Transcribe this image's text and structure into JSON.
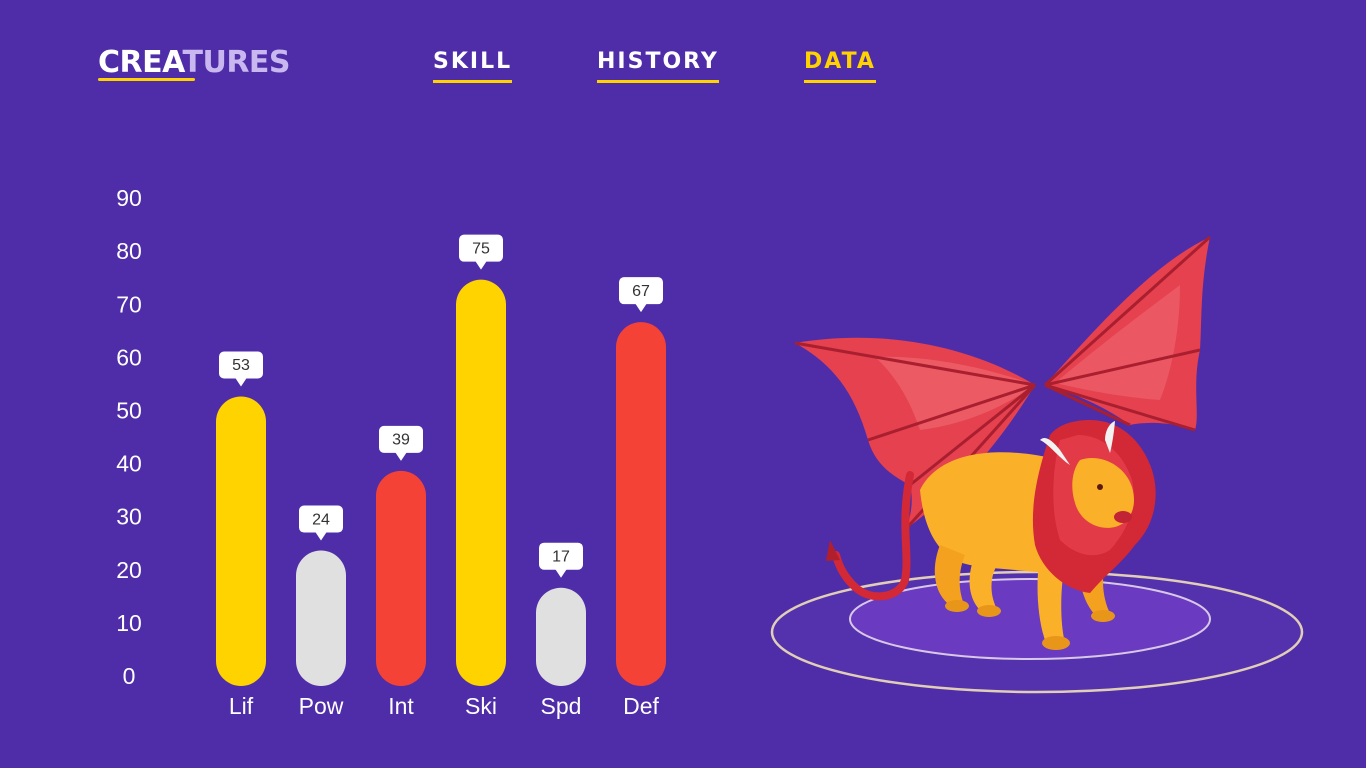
{
  "header": {
    "logo_part1": "CREA",
    "logo_part2": "TURES",
    "nav": [
      {
        "label": "SKILL",
        "active": false
      },
      {
        "label": "HISTORY",
        "active": false
      },
      {
        "label": "DATA",
        "active": true
      }
    ]
  },
  "colors": {
    "background": "#4F2DA8",
    "accent_yellow": "#FFD300",
    "accent_red": "#F44336",
    "neutral_gray": "#E0E0E0"
  },
  "chart_data": {
    "type": "bar",
    "title": "",
    "xlabel": "",
    "ylabel": "",
    "ylim": [
      0,
      90
    ],
    "yticks": [
      0,
      10,
      20,
      30,
      40,
      50,
      60,
      70,
      80,
      90
    ],
    "grid": false,
    "legend": "none",
    "categories": [
      "Lif",
      "Pow",
      "Int",
      "Ski",
      "Spd",
      "Def"
    ],
    "values": [
      53,
      24,
      39,
      75,
      17,
      67
    ],
    "bar_colors": [
      "#FFD300",
      "#E0E0E0",
      "#F44336",
      "#FFD300",
      "#E0E0E0",
      "#F44336"
    ],
    "data_labels": [
      "53",
      "24",
      "39",
      "75",
      "17",
      "67"
    ]
  },
  "illustration": {
    "subject": "winged-lion-creature"
  }
}
